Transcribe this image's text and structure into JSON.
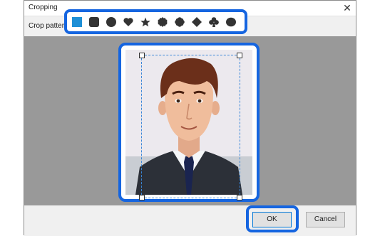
{
  "window": {
    "title": "Cropping",
    "close_glyph": "✕"
  },
  "crop_pattern": {
    "label": "Crop pattern",
    "shapes": [
      {
        "name": "square-light-icon",
        "color": "#1e8fd6",
        "selected": true
      },
      {
        "name": "rounded-square-icon",
        "color": "#333333"
      },
      {
        "name": "circle-icon",
        "color": "#333333"
      },
      {
        "name": "heart-icon",
        "color": "#333333"
      },
      {
        "name": "star-icon",
        "color": "#333333"
      },
      {
        "name": "seal-icon",
        "color": "#333333"
      },
      {
        "name": "flower-icon",
        "color": "#333333"
      },
      {
        "name": "diamond-icon",
        "color": "#333333"
      },
      {
        "name": "clover-icon",
        "color": "#333333"
      },
      {
        "name": "oval-icon",
        "color": "#333333"
      }
    ]
  },
  "buttons": {
    "ok": "OK",
    "cancel": "Cancel"
  },
  "colors": {
    "highlight": "#1565e0",
    "preview_background": "#999999"
  }
}
